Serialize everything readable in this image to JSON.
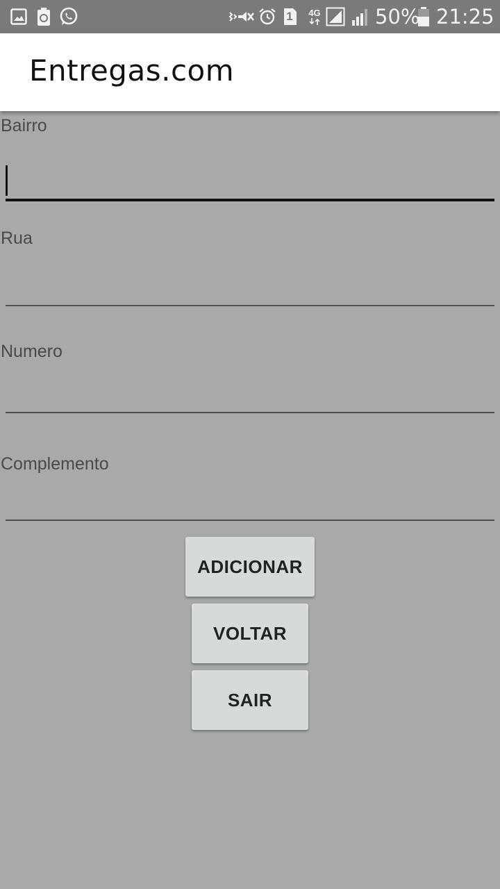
{
  "status_bar": {
    "left_icons": [
      "gallery-icon",
      "recycle-battery-icon",
      "whatsapp-icon"
    ],
    "right_icons": [
      "vibrate-icon",
      "alarm-icon",
      "sim-icon",
      "network-4g-icon",
      "signal-icon",
      "signal-icon"
    ],
    "sim_number": "1",
    "network_label": "4G",
    "battery_percent": "50%",
    "time": "21:25"
  },
  "app_bar": {
    "title": "Entregas.com"
  },
  "form": {
    "bairro_label": "Bairro",
    "rua_label": "Rua",
    "numero_label": "Numero",
    "complemento_label": "Complemento"
  },
  "buttons": {
    "adicionar": "ADICIONAR",
    "voltar": "VOLTAR",
    "sair": "SAIR"
  },
  "colors": {
    "background": "#a9a9a9",
    "status_bar": "#7a7a7a",
    "app_bar": "#ffffff",
    "button": "#d8d9d9"
  }
}
